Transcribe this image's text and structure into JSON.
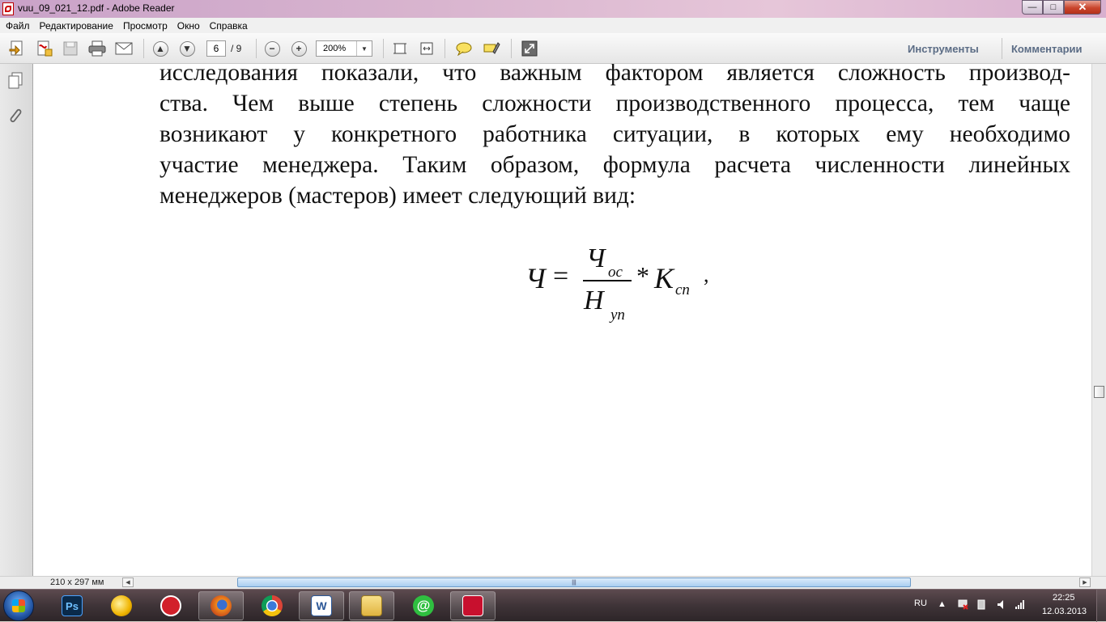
{
  "window": {
    "title": "vuu_09_021_12.pdf - Adobe Reader",
    "controls": {
      "minimize": "—",
      "maximize": "□",
      "close": "✕"
    }
  },
  "menu": [
    "Файл",
    "Редактирование",
    "Просмотр",
    "Окно",
    "Справка"
  ],
  "toolbar": {
    "page_current": "6",
    "page_total": "/ 9",
    "zoom": "200%",
    "tools_label": "Инструменты",
    "comments_label": "Комментарии"
  },
  "document": {
    "paragraph": "исследования показали, что важным фактором является сложность производства. Чем выше степень сложности производственного процесса, тем чаще возникают у конкретного работника ситуации, в которых ему необходимо участие менеджера. Таким образом, формула расчета численности линейных менеджеров (мастеров) имеет следующий вид:",
    "lines": [
      "исследования показали, что важным фактором является сложность производ-",
      "ства. Чем выше степень сложности производственного процесса, тем чаще",
      "возникают у конкретного работника ситуации, в которых ему необходимо",
      "участие менеджера. Таким образом, формула расчета численности линейных",
      "менеджеров (мастеров) имеет следующий вид:"
    ],
    "formula": {
      "lhs": "Ч",
      "eq": "=",
      "numerator": "Ч",
      "numerator_sub": "ос",
      "denominator": "Н",
      "denominator_sub": "уп",
      "operator": "*",
      "factor": "К",
      "factor_sub": "сп",
      "trail": ","
    }
  },
  "status": {
    "page_size": "210 x 297 мм"
  },
  "taskbar": {
    "apps": [
      "photoshop",
      "yandex-browser",
      "scan-app",
      "firefox",
      "chrome",
      "word",
      "explorer",
      "mail-agent",
      "adobe-reader"
    ],
    "language": "RU",
    "time": "22:25",
    "date": "12.03.2013"
  }
}
